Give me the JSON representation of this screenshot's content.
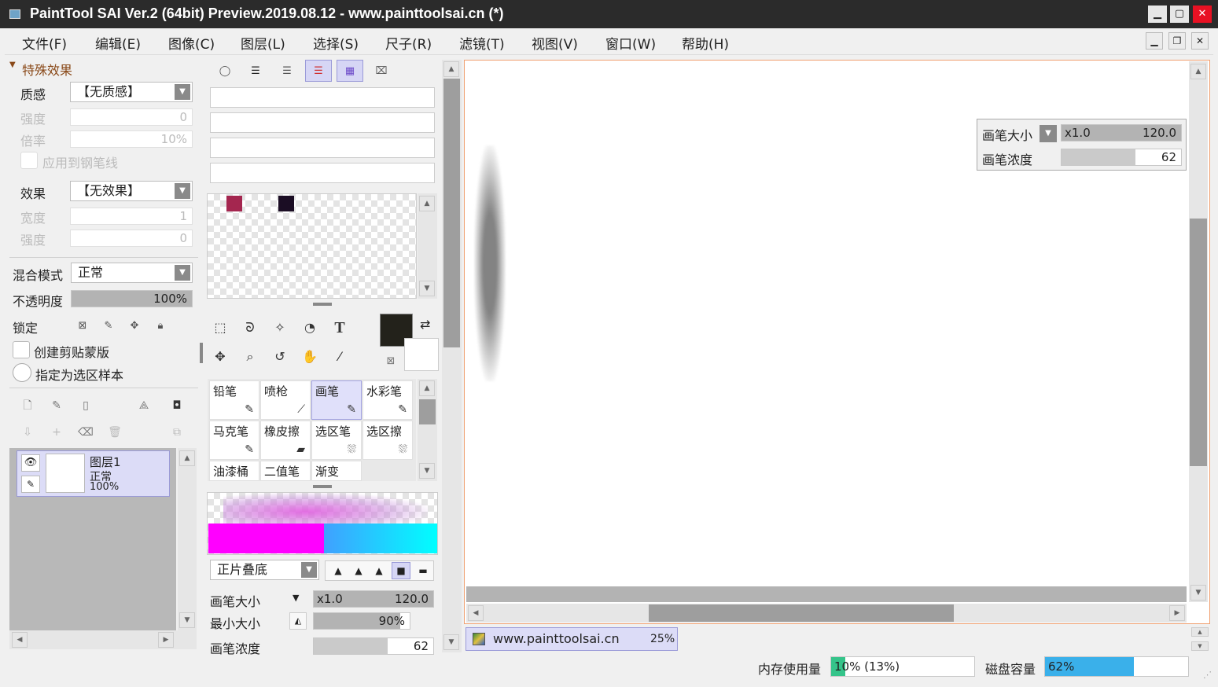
{
  "window": {
    "title": "PaintTool SAI Ver.2 (64bit) Preview.2019.08.12 - www.painttoolsai.cn (*)"
  },
  "menu": [
    {
      "label": "文件(F)"
    },
    {
      "label": "编辑(E)"
    },
    {
      "label": "图像(C)"
    },
    {
      "label": "图层(L)"
    },
    {
      "label": "选择(S)"
    },
    {
      "label": "尺子(R)"
    },
    {
      "label": "滤镜(T)"
    },
    {
      "label": "视图(V)"
    },
    {
      "label": "窗口(W)"
    },
    {
      "label": "帮助(H)"
    }
  ],
  "effects": {
    "header": "特殊效果",
    "texture_label": "质感",
    "texture_value": "【无质感】",
    "texture_strength_label": "强度",
    "texture_strength_value": "0",
    "scale_label": "倍率",
    "scale_value": "10%",
    "apply_pen_label": "应用到钢笔线",
    "effect_label": "效果",
    "effect_value": "【无效果】",
    "width_label": "宽度",
    "width_value": "1",
    "effect_strength_label": "强度",
    "effect_strength_value": "0"
  },
  "layer_props": {
    "blend_label": "混合模式",
    "blend_value": "正常",
    "opacity_label": "不透明度",
    "opacity_value": "100%",
    "opacity_fraction": 1.0,
    "lock_label": "锁定",
    "clip_label": "创建剪贴蒙版",
    "selection_source_label": "指定为选区样本"
  },
  "layers": [
    {
      "name": "图层1",
      "mode": "正常",
      "opacity": "100%"
    }
  ],
  "swatches": [
    "#a4264f",
    "#1b0d24"
  ],
  "colors": {
    "primary": "#23221b",
    "secondary": "#ffffff",
    "accent": "#9a9ad8"
  },
  "tools": [
    {
      "icon": "rect-select-icon",
      "glyph": "⬚"
    },
    {
      "icon": "lasso-icon",
      "glyph": "ᘐ"
    },
    {
      "icon": "magic-wand-icon",
      "glyph": "✧"
    },
    {
      "icon": "shape-icon",
      "glyph": "◔"
    },
    {
      "icon": "text-icon",
      "glyph": "T"
    },
    {
      "icon": "move-icon",
      "glyph": "✥"
    },
    {
      "icon": "zoom-icon",
      "glyph": "⌕"
    },
    {
      "icon": "rotate-icon",
      "glyph": "↺"
    },
    {
      "icon": "hand-icon",
      "glyph": "✋"
    },
    {
      "icon": "eyedropper-icon",
      "glyph": "⁄"
    }
  ],
  "brushes": [
    {
      "label": "铅笔",
      "active": false
    },
    {
      "label": "喷枪",
      "active": false
    },
    {
      "label": "画笔",
      "active": true
    },
    {
      "label": "水彩笔",
      "active": false
    },
    {
      "label": "马克笔",
      "active": false
    },
    {
      "label": "橡皮擦",
      "active": false
    },
    {
      "label": "选区笔",
      "active": false
    },
    {
      "label": "选区擦",
      "active": false
    },
    {
      "label": "油漆桶",
      "active": false
    },
    {
      "label": "二值笔",
      "active": false
    },
    {
      "label": "渐变",
      "active": false
    }
  ],
  "brush_settings": {
    "blend_value": "正片叠底",
    "size_label": "画笔大小",
    "size_multiplier": "x1.0",
    "size_value": "120.0",
    "min_size_label": "最小大小",
    "min_size_value": "90%",
    "min_size_fraction": 0.9,
    "density_label": "画笔浓度",
    "density_value": "62",
    "density_fraction": 0.62
  },
  "overlay": {
    "size_label": "画笔大小",
    "size_multiplier": "x1.0",
    "size_value": "120.0",
    "density_label": "画笔浓度",
    "density_value": "62",
    "density_fraction": 0.62
  },
  "document_tab": {
    "name": "www.painttoolsai.cn",
    "zoom": "25%"
  },
  "status": {
    "memory_label": "内存使用量",
    "memory_value": "10% (13%)",
    "memory_fraction": 0.1,
    "disk_label": "磁盘容量",
    "disk_value": "62%",
    "disk_fraction": 0.62
  }
}
